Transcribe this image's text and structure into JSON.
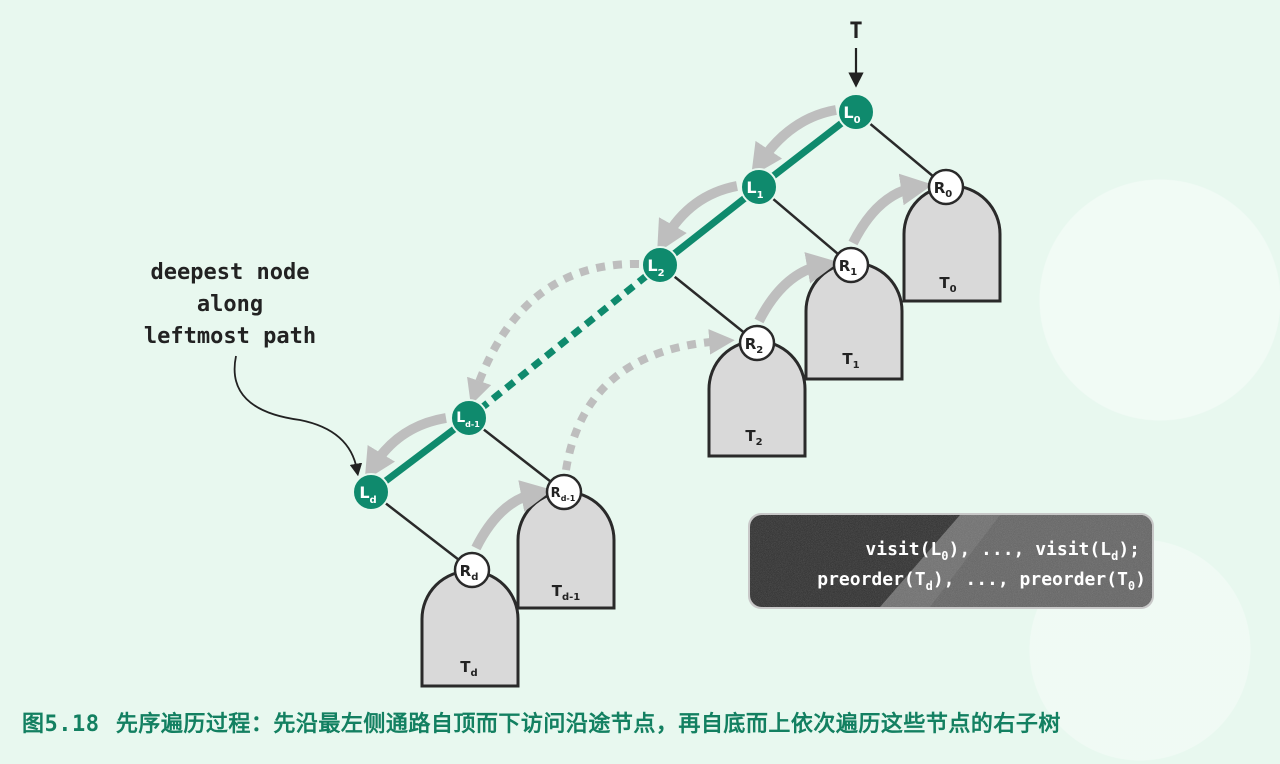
{
  "diagram": {
    "root_label": "T",
    "annotation_lines": [
      "deepest node",
      "along",
      "leftmost path"
    ],
    "code_lines": [
      [
        {
          "t": "visit(L"
        },
        {
          "t": "0",
          "sub": true
        },
        {
          "t": "), ..., visit(L"
        },
        {
          "t": "d",
          "sub": true
        },
        {
          "t": ");"
        }
      ],
      [
        {
          "t": "preorder(T"
        },
        {
          "t": "d",
          "sub": true
        },
        {
          "t": "), ..., preorder(T"
        },
        {
          "t": "0",
          "sub": true
        },
        {
          "t": ")"
        }
      ]
    ],
    "left_nodes": [
      {
        "base": "L",
        "sub": "0"
      },
      {
        "base": "L",
        "sub": "1"
      },
      {
        "base": "L",
        "sub": "2"
      },
      {
        "base": "L",
        "sub": "d-1"
      },
      {
        "base": "L",
        "sub": "d"
      }
    ],
    "right_nodes": [
      {
        "base": "R",
        "sub": "0"
      },
      {
        "base": "R",
        "sub": "1"
      },
      {
        "base": "R",
        "sub": "2"
      },
      {
        "base": "R",
        "sub": "d-1"
      },
      {
        "base": "R",
        "sub": "d"
      }
    ],
    "subtrees": [
      {
        "base": "T",
        "sub": "0"
      },
      {
        "base": "T",
        "sub": "1"
      },
      {
        "base": "T",
        "sub": "2"
      },
      {
        "base": "T",
        "sub": "d-1"
      },
      {
        "base": "T",
        "sub": "d"
      }
    ]
  },
  "caption": {
    "fig_label": "图",
    "fig_number": "5.18",
    "text": "先序遍历过程：先沿最左侧通路自顶而下访问沿途节点，再自底而上依次遍历这些节点的右子树"
  },
  "colors": {
    "background": "#e8f8ef",
    "teal": "#0f8a6d",
    "gray_arrow": "#bebebe",
    "subtree_fill": "#d9d9d9",
    "caption": "#138061"
  }
}
